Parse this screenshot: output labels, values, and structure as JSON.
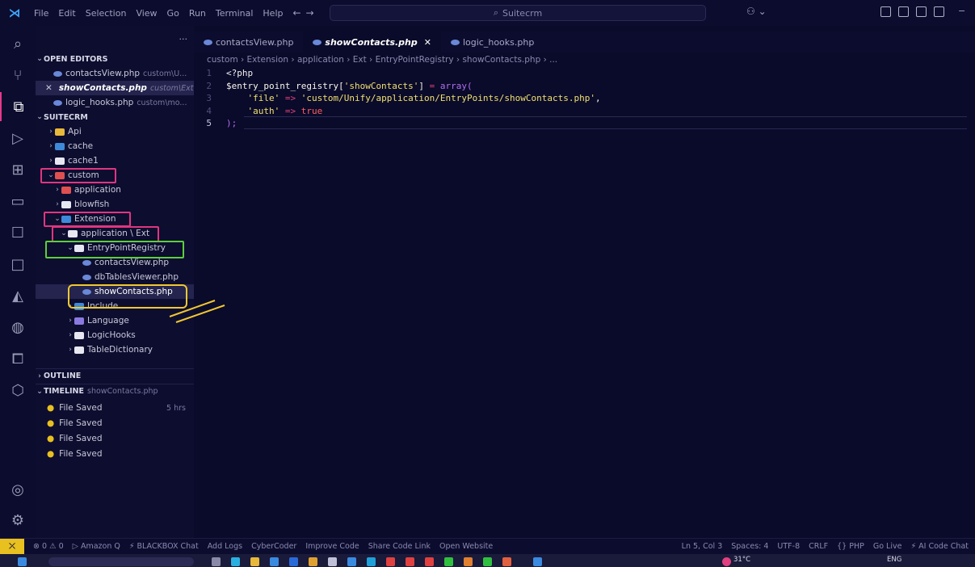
{
  "menu": [
    "File",
    "Edit",
    "Selection",
    "View",
    "Go",
    "Run",
    "Terminal",
    "Help"
  ],
  "search_text": "Suitecrm",
  "account_icon": "copilot-icon",
  "sidebar": {
    "more": "···",
    "open_editors_label": "OPEN EDITORS",
    "open_editors": [
      {
        "name": "contactsView.php",
        "path": "custom\\U..."
      },
      {
        "name": "showContacts.php",
        "path": "custom\\Ext..."
      },
      {
        "name": "logic_hooks.php",
        "path": "custom\\mo..."
      }
    ],
    "close_glyph": "✕",
    "project_label": "SUITECRM",
    "tree": {
      "api": "Api",
      "cache": "cache",
      "cache1": "cache1",
      "custom": "custom",
      "application": "application",
      "blowfish": "blowfish",
      "extension": "Extension",
      "application_ext": "application \\ Ext",
      "entry_point_registry": "EntryPointRegistry",
      "contacts_view": "contactsView.php",
      "db_tables_viewer": "dbTablesViewer.php",
      "show_contacts": "showContacts.php",
      "include": "Include",
      "language": "Language",
      "logic_hooks": "LogicHooks",
      "table_dictionary": "TableDictionary"
    },
    "outline_label": "OUTLINE",
    "timeline_label": "TIMELINE",
    "timeline_file": "showContacts.php",
    "timeline": [
      {
        "label": "File Saved",
        "time": "5 hrs"
      },
      {
        "label": "File Saved",
        "time": ""
      },
      {
        "label": "File Saved",
        "time": ""
      },
      {
        "label": "File Saved",
        "time": ""
      }
    ]
  },
  "tabs": [
    {
      "label": "contactsView.php"
    },
    {
      "label": "showContacts.php",
      "close": "✕"
    },
    {
      "label": "logic_hooks.php"
    }
  ],
  "breadcrumb": "custom › Extension › application › Ext › EntryPointRegistry › showContacts.php › ...",
  "code": {
    "line_numbers": [
      "1",
      "2",
      "3",
      "4",
      "5"
    ],
    "l1": "<?php",
    "l2_var": "$entry_point_registry[",
    "l2_key": "'showContacts'",
    "l2_mid": "] ",
    "l2_op": "=",
    "l2_fn": " array(",
    "l3_key": "    'file'",
    "l3_op": " =>",
    "l3_val": " 'custom/Unify/application/EntryPoints/showContacts.php'",
    "l3_end": ",",
    "l4_key": "    'auth'",
    "l4_op": " =>",
    "l4_val": " true",
    "l5": ");"
  },
  "status": {
    "remote": "⤫",
    "problems": "⊗ 0 ⚠ 0",
    "items": [
      "▷ Amazon Q",
      "⚡ BLACKBOX Chat",
      "Add Logs",
      "CyberCoder",
      "Improve Code",
      "Share Code Link",
      "Open Website"
    ],
    "right": [
      "Ln 5, Col 3",
      "Spaces: 4",
      "UTF-8",
      "CRLF",
      "{} PHP",
      "Go Live",
      "⚡ AI Code Chat"
    ]
  },
  "taskbar": {
    "weather": "31°C",
    "lang": "ENG"
  },
  "colors": {
    "highlight_red": "#e0367e",
    "highlight_green": "#5ccf3a",
    "highlight_yellow": "#f0c830"
  }
}
